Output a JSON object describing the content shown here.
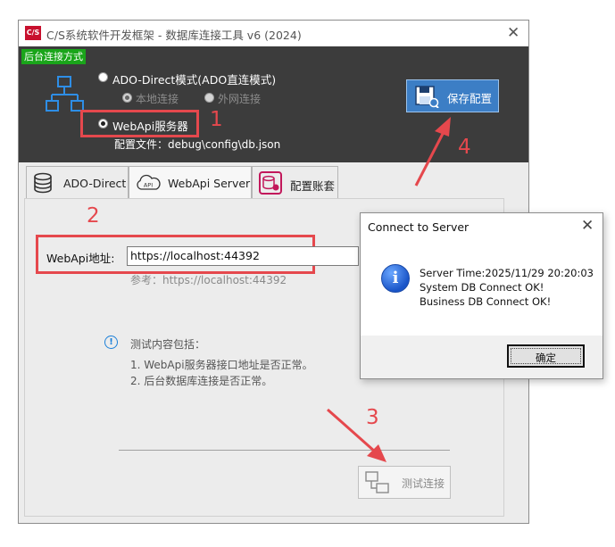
{
  "window": {
    "title": "C/S系统软件开发框架 - 数据库连接工具 v6 (2024)",
    "app_icon_text": "C/S",
    "close_glyph": "✕"
  },
  "header": {
    "mode_label": "后台连接方式",
    "ado_option": "ADO-Direct模式(ADO直连模式)",
    "local_option": "本地连接",
    "extranet_option": "外网连接",
    "webapi_option": "WebApi服务器",
    "config_file": "配置文件：debug\\config\\db.json",
    "save_button": "保存配置",
    "selected_mode": "WebApi服务器"
  },
  "annotations": {
    "n1": "1",
    "n2": "2",
    "n3": "3",
    "n4": "4",
    "accent": "#e5484d"
  },
  "tabs": [
    {
      "label": "ADO-Direct",
      "icon": "database-icon",
      "active": false
    },
    {
      "label": "WebApi Server",
      "icon": "api-cloud-icon",
      "active": true
    },
    {
      "label": "配置账套",
      "icon": "account-set-icon",
      "active": false
    }
  ],
  "form": {
    "url_label": "WebApi地址:",
    "url_value": "https://localhost:44392",
    "hint": "参考：https://localhost:44392"
  },
  "info": {
    "title": "测试内容包括：",
    "lines": [
      "1. WebApi服务器接口地址是否正常。",
      "2. 后台数据库连接是否正常。"
    ]
  },
  "test_button": "测试连接",
  "dialog": {
    "title": "Connect to Server",
    "close_glyph": "✕",
    "lines": [
      "Server Time:2025/11/29 20:20:03",
      "System DB Connect OK!",
      "Business DB Connect OK!"
    ],
    "ok_button": "确定"
  },
  "colors": {
    "header_bg": "#3c3c3c",
    "mode_label_bg": "#1aa51a",
    "save_button_bg": "#3c7ec5",
    "info_icon": "#1a7fd8"
  }
}
